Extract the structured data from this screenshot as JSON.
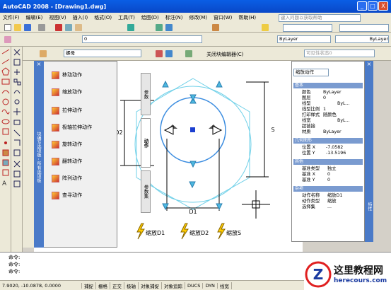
{
  "window": {
    "title": "AutoCAD 2008 - [Drawing1.dwg]",
    "min": "_",
    "max": "□",
    "close": "X"
  },
  "menu": [
    "文件(F)",
    "编辑(E)",
    "视图(V)",
    "插入(I)",
    "格式(O)",
    "工具(T)",
    "绘图(D)",
    "标注(N)",
    "修改(M)",
    "窗口(W)",
    "帮助(H)"
  ],
  "help_placeholder": "键入问题以获取帮助",
  "toolbar": {
    "layer": "0",
    "color": "ByLayer",
    "linetype": "ByLayer",
    "block_name": "螺母",
    "close_editor": "关闭块编辑器(C)",
    "visibility": "可见性状态0"
  },
  "palette": {
    "title": "块编写选项板 - 所有选项板",
    "items": [
      "移动动作",
      "缩放动作",
      "拉伸动作",
      "极轴拉伸动作",
      "旋转动作",
      "翻转动作",
      "阵列动作",
      "查寻动作"
    ],
    "tabs": [
      "参数",
      "动作",
      "参数集"
    ]
  },
  "drawing": {
    "dim_left": "D2",
    "dim_right": "S",
    "dim_bottom": "D1",
    "actions": [
      "缩放D1",
      "缩放D2",
      "缩放S"
    ]
  },
  "props": {
    "dropdown": "缩放动作",
    "sections": {
      "basic": "基本",
      "geometry": "几何图形",
      "other": "其他",
      "misc": "杂项"
    },
    "basic": [
      [
        "颜色",
        "ByLayer"
      ],
      [
        "图层",
        "0"
      ],
      [
        "线型",
        "ByL..."
      ],
      [
        "线型比例",
        "1"
      ],
      [
        "打印样式",
        "随颜色"
      ],
      [
        "线宽",
        "ByL..."
      ],
      [
        "超链接",
        ""
      ],
      [
        "材质",
        "ByLayer"
      ]
    ],
    "geometry": [
      [
        "位置 X",
        "-7.0582"
      ],
      [
        "位置 Y",
        "-13.5196"
      ]
    ],
    "other": [
      [
        "基准类型",
        "独立"
      ],
      [
        "基准 X",
        "0"
      ],
      [
        "基准 Y",
        "0"
      ]
    ],
    "misc": [
      [
        "动作名称",
        "缩放D1"
      ],
      [
        "动作类型",
        "缩放"
      ],
      [
        "选择集",
        "..."
      ]
    ],
    "side_tab": "特性"
  },
  "command": [
    "命令:",
    "命令:",
    "命令:"
  ],
  "status": {
    "coords": "7.9020, -10.0878, 0.0000",
    "buttons": [
      "捕捉",
      "栅格",
      "正交",
      "极轴",
      "对象捕捉",
      "对象追踪",
      "DUCS",
      "DYN",
      "线宽"
    ]
  },
  "watermark": {
    "title": "这里教程网",
    "url": "herecours.com"
  }
}
